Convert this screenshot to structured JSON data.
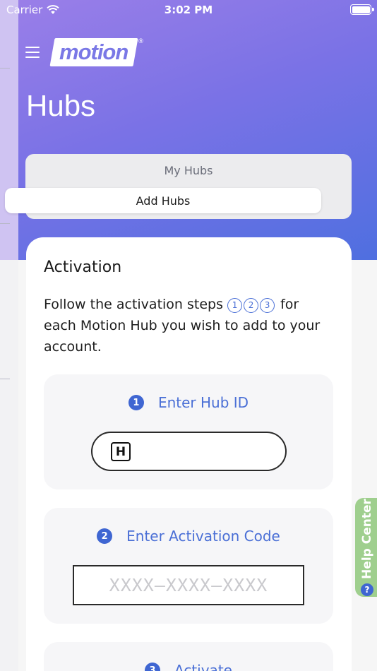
{
  "status_bar": {
    "carrier": "Carrier",
    "time": "3:02 PM"
  },
  "header": {
    "logo_text": "motion",
    "logo_mark": "®",
    "page_title": "Hubs"
  },
  "segmented": {
    "my_hubs": "My Hubs",
    "add_hubs": "Add Hubs",
    "selected": "Add Hubs"
  },
  "card": {
    "title": "Activation",
    "description_before": "Follow the activation steps",
    "description_after": "for each Motion Hub you wish to add to your account.",
    "step_glyphs": [
      "1",
      "2",
      "3"
    ]
  },
  "steps": [
    {
      "number": "1",
      "label": "Enter Hub ID",
      "input_icon": "H"
    },
    {
      "number": "2",
      "label": "Enter Activation Code",
      "placeholder": "XXXX–XXXX–XXXX"
    },
    {
      "number": "3",
      "label": "Activate"
    }
  ],
  "help_center": {
    "label": "Help Center",
    "icon": "?"
  },
  "colors": {
    "accent": "#4a6fd6",
    "gradient_start": "#9b7fe8",
    "gradient_end": "#4f6fe0",
    "help_tab": "#9fcf8e"
  }
}
